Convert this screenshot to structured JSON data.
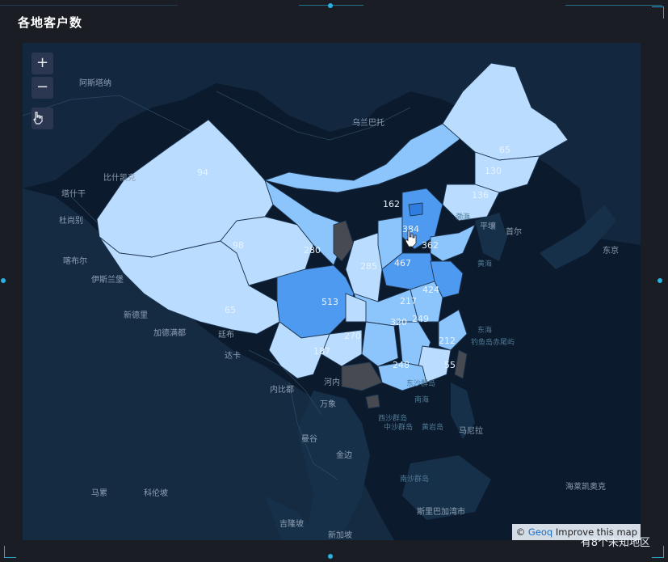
{
  "panel": {
    "title": "各地客户数",
    "footnote": "有8个未知地区"
  },
  "map": {
    "zoom_in_label": "+",
    "zoom_out_label": "−",
    "attribution_prefix": "© ",
    "attribution_link": "Geoq",
    "attribution_improve": "Improve this map",
    "colors": {
      "background": "#0b1a2c",
      "land": "#17324a",
      "low": "#b9dcff",
      "mid": "#8cc5fc",
      "high": "#4e9af0",
      "highest": "#2f7de0",
      "nodata": "#474a50"
    },
    "place_labels": [
      "阿斯塔纳",
      "乌兰巴托",
      "比什凯克",
      "塔什干",
      "杜尚别",
      "喀布尔",
      "伊斯兰堡",
      "新德里",
      "加德满都",
      "廷布",
      "达卡",
      "内比都",
      "河内",
      "万象",
      "曼谷",
      "金边",
      "马尼拉",
      "平壤",
      "首尔",
      "东京",
      "斯里巴加湾市",
      "吉隆坡",
      "新加坡",
      "马累",
      "科伦坡",
      "海莱凯奥克"
    ],
    "sea_labels": [
      "渤海",
      "黄海",
      "东海",
      "钓鱼岛",
      "赤尾屿",
      "东沙群岛",
      "南海",
      "西沙群岛",
      "中沙群岛",
      "黄岩岛",
      "南沙群岛"
    ],
    "region_values": [
      "94",
      "65",
      "513",
      "467",
      "384",
      "362",
      "285",
      "249",
      "320",
      "217",
      "424",
      "212",
      "248",
      "187",
      "162",
      "136",
      "130",
      "280",
      "270",
      "98",
      "65",
      "55"
    ]
  }
}
